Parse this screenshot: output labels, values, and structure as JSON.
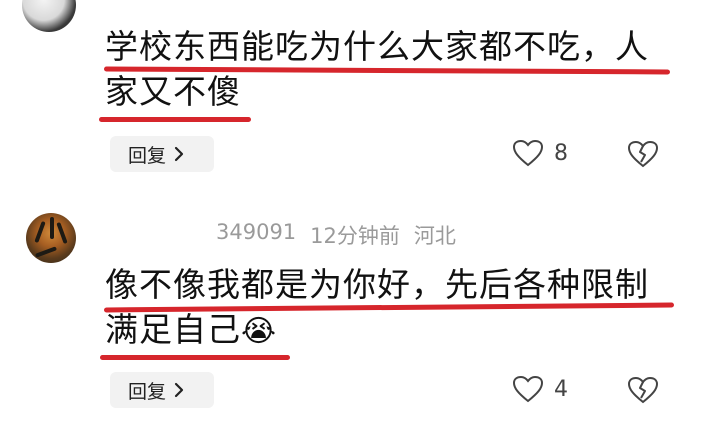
{
  "comments": [
    {
      "text_line1": "学校东西能吃为什么大家都不吃，人",
      "text_line2": "家又不傻",
      "reply_label": "回复",
      "like_count": "8"
    },
    {
      "username": "349091",
      "time": "12分钟前",
      "location": "河北",
      "text_line1": "像不像我都是为你好，先后各种限制",
      "text_line2": "满足自己",
      "emoji": "😭",
      "reply_label": "回复",
      "like_count": "4"
    }
  ],
  "colors": {
    "underline": "#d6262c",
    "reply_bg": "#f2f2f2",
    "meta": "#9a9a9a"
  },
  "icons": [
    "heart-outline-icon",
    "broken-heart-icon",
    "chevron-right-icon"
  ]
}
